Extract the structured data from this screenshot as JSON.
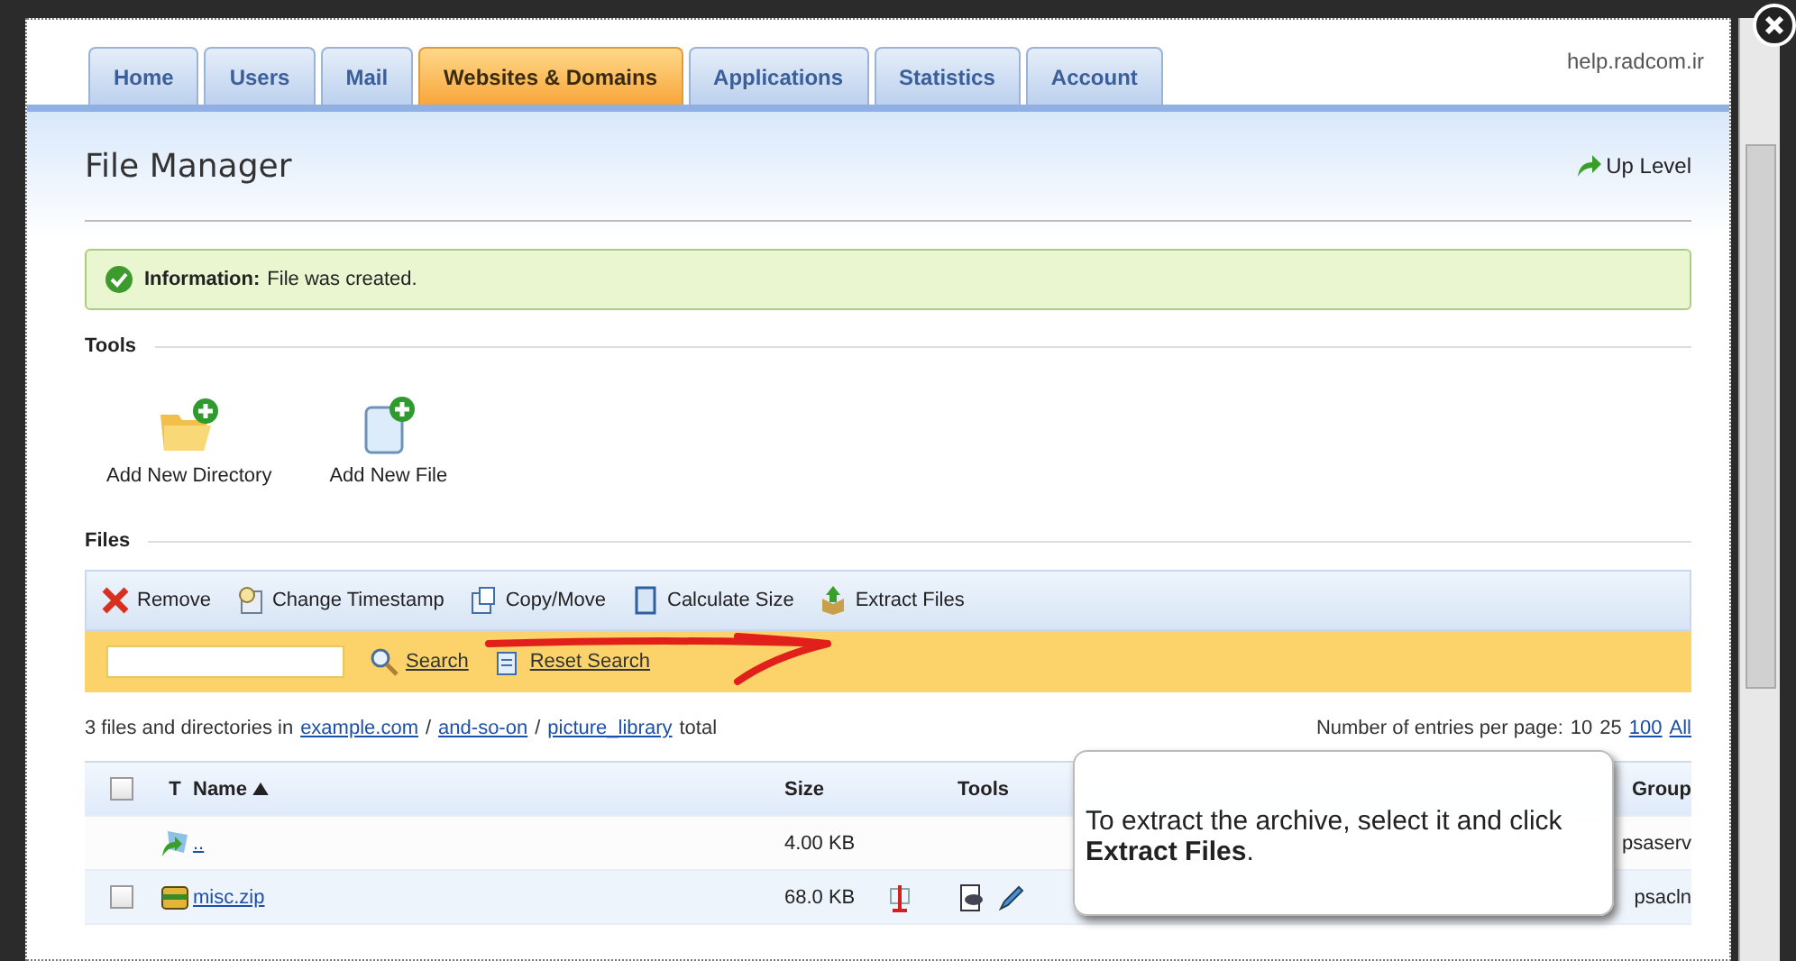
{
  "tabs": [
    {
      "label": "Home",
      "selected": false
    },
    {
      "label": "Users",
      "selected": false
    },
    {
      "label": "Mail",
      "selected": false
    },
    {
      "label": "Websites & Domains",
      "selected": true
    },
    {
      "label": "Applications",
      "selected": false
    },
    {
      "label": "Statistics",
      "selected": false
    },
    {
      "label": "Account",
      "selected": false
    }
  ],
  "site_label": "help.radcom.ir",
  "page_title": "File Manager",
  "up_level": "Up Level",
  "info": {
    "label": "Information:",
    "text": "File was created."
  },
  "tools_section": {
    "title": "Tools",
    "items": [
      {
        "label": "Add New Directory",
        "kind": "folder"
      },
      {
        "label": "Add New File",
        "kind": "file"
      }
    ]
  },
  "files_section": {
    "title": "Files",
    "toolbar": [
      {
        "label": "Remove",
        "kind": "remove"
      },
      {
        "label": "Change Timestamp",
        "kind": "timestamp"
      },
      {
        "label": "Copy/Move",
        "kind": "copy"
      },
      {
        "label": "Calculate Size",
        "kind": "calc"
      },
      {
        "label": "Extract Files",
        "kind": "extract"
      }
    ],
    "search_button": "Search",
    "reset_button": "Reset Search",
    "path": {
      "prefix": "3 files and directories in",
      "links": [
        "example.com",
        "and-so-on",
        "picture_library"
      ],
      "separator": "/",
      "suffix": "total"
    },
    "entries": {
      "label": "Number of entries per page:",
      "options": [
        {
          "label": "10",
          "link": false
        },
        {
          "label": "25",
          "link": false
        },
        {
          "label": "100",
          "link": true
        },
        {
          "label": "All",
          "link": true
        }
      ]
    },
    "header_checkbox": {
      "checked": false
    },
    "columns": [
      "T",
      "Name",
      "Size",
      "Tools",
      "Group"
    ],
    "rows": [
      {
        "kind": "parent",
        "name": "..",
        "size": "4.00 KB",
        "group": "psaserv"
      },
      {
        "kind": "archive",
        "name": "misc.zip",
        "size": "68.0 KB",
        "group": "psacln",
        "checked": false
      }
    ]
  },
  "tooltip": "To extract the archive, select it and click **Extract Files**."
}
